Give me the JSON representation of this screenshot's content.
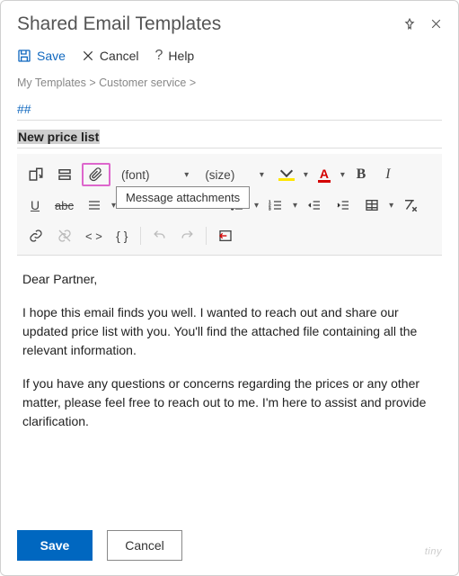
{
  "header": {
    "title": "Shared Email Templates"
  },
  "actions": {
    "save": "Save",
    "cancel": "Cancel",
    "help": "Help"
  },
  "breadcrumb": {
    "root": "My Templates",
    "folder": "Customer service"
  },
  "fields": {
    "shortcut": "##",
    "subject": "New price list"
  },
  "toolbar": {
    "font_label": "(font)",
    "size_label": "(size)",
    "tooltip": "Message attachments",
    "fontcolor_letter": "A",
    "bold": "B",
    "italic": "I",
    "underline": "U",
    "strike": "abc",
    "code": "< >",
    "braces": "{ }"
  },
  "body": {
    "p1": "Dear Partner,",
    "p2": "I hope this email finds you well. I wanted to reach out and share our updated price list with you. You'll find the attached file containing all the relevant information.",
    "p3": "If you have any questions or concerns regarding the prices or any other matter, please feel free to reach out to me. I'm here to assist and provide clarification."
  },
  "footer": {
    "save": "Save",
    "cancel": "Cancel",
    "brand": "tiny"
  }
}
